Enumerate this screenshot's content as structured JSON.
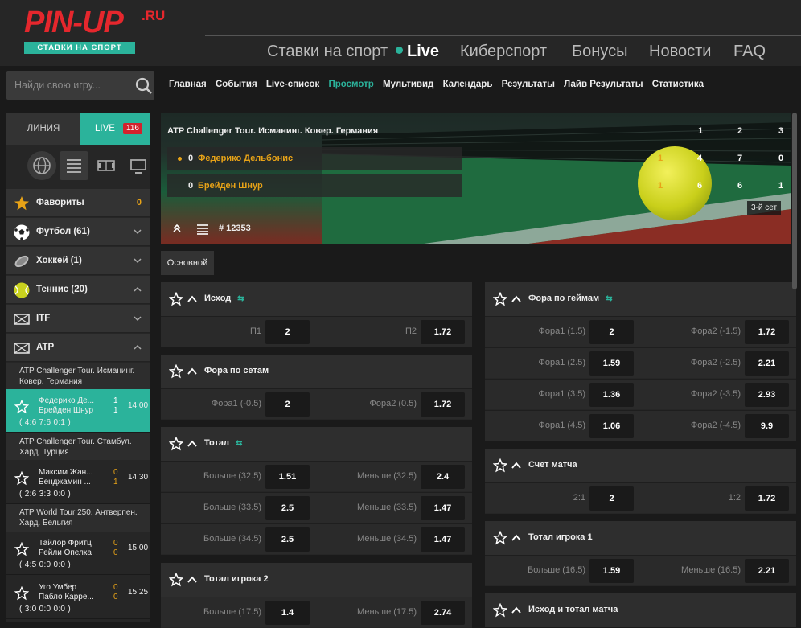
{
  "header": {
    "logo_text": "PIN-UP",
    "logo_ru": ".RU",
    "logo_sub": "СТАВКИ НА СПОРТ",
    "nav": [
      {
        "label": "Ставки на спорт"
      },
      {
        "label": "Live"
      },
      {
        "label": "Киберспорт"
      },
      {
        "label": "Бонусы"
      },
      {
        "label": "Новости"
      },
      {
        "label": "FAQ"
      }
    ]
  },
  "search": {
    "placeholder": "Найди свою игру..."
  },
  "subnav": [
    "Главная",
    "События",
    "Live-список",
    "Просмотр",
    "Мультивид",
    "Календарь",
    "Результаты",
    "Лайв Результаты",
    "Статистика"
  ],
  "sidebar": {
    "tab_line": "ЛИНИЯ",
    "tab_live": "LIVE",
    "live_count": "116",
    "sports": [
      {
        "label": "Фавориты",
        "count": "0"
      },
      {
        "label": "Футбол (61)"
      },
      {
        "label": "Хоккей (1)"
      },
      {
        "label": "Теннис (20)"
      },
      {
        "label": "ITF"
      },
      {
        "label": "ATP"
      }
    ],
    "leagues": [
      "ATP Challenger Tour. Исманинг. Ковер. Германия",
      "ATP Challenger Tour. Стамбул. Хард. Турция",
      "ATP World Tour 250. Антверпен. Хард. Бельгия"
    ],
    "matches": [
      {
        "p1": "Федерико Де...",
        "p2": "Брейден Шнур",
        "s1": "1",
        "s2": "1",
        "time": "14:00",
        "sets": "( 4:6  7:6  0:1 )"
      },
      {
        "p1": "Максим Жан...",
        "p2": "Бенджамин ...",
        "s1": "0",
        "s2": "1",
        "time": "14:30",
        "sets": "( 2:6  3:3  0:0 )"
      },
      {
        "p1": "Тайлор Фритц",
        "p2": "Рейли Опелка",
        "s1": "0",
        "s2": "0",
        "time": "15:00",
        "sets": "( 4:5  0:0  0:0 )"
      },
      {
        "p1": "Уго Умбер",
        "p2": "Пабло Карре...",
        "s1": "0",
        "s2": "0",
        "time": "15:25",
        "sets": "( 3:0  0:0  0:0 )"
      }
    ]
  },
  "event": {
    "title": "ATP Challenger Tour. Исманинг. Ковер. Германия",
    "set_headers": [
      "1",
      "2",
      "3"
    ],
    "players": [
      {
        "serve": "0",
        "name": "Федерико Дельбонис",
        "game": "1",
        "sets": [
          "4",
          "7",
          "0"
        ]
      },
      {
        "serve": "0",
        "name": "Брейден Шнур",
        "game": "1",
        "sets": [
          "6",
          "6",
          "1"
        ]
      }
    ],
    "set_label": "3-й сет",
    "event_id": "# 12353",
    "main_tab": "Основной"
  },
  "markets_left": [
    {
      "title": "Исход",
      "icon": true,
      "rows": [
        {
          "l1": "П1",
          "o1": "2",
          "l2": "П2",
          "o2": "1.72"
        }
      ]
    },
    {
      "title": "Фора по сетам",
      "icon": false,
      "rows": [
        {
          "l1": "Фора1 (-0.5)",
          "o1": "2",
          "l2": "Фора2 (0.5)",
          "o2": "1.72"
        }
      ]
    },
    {
      "title": "Тотал",
      "icon": true,
      "rows": [
        {
          "l1": "Больше (32.5)",
          "o1": "1.51",
          "l2": "Меньше (32.5)",
          "o2": "2.4"
        },
        {
          "l1": "Больше (33.5)",
          "o1": "2.5",
          "l2": "Меньше (33.5)",
          "o2": "1.47"
        },
        {
          "l1": "Больше (34.5)",
          "o1": "2.5",
          "l2": "Меньше (34.5)",
          "o2": "1.47"
        }
      ]
    },
    {
      "title": "Тотал игрока 2",
      "icon": false,
      "rows": [
        {
          "l1": "Больше (17.5)",
          "o1": "1.4",
          "l2": "Меньше (17.5)",
          "o2": "2.74"
        }
      ]
    }
  ],
  "markets_right": [
    {
      "title": "Фора по геймам",
      "icon": true,
      "rows": [
        {
          "l1": "Фора1 (1.5)",
          "o1": "2",
          "l2": "Фора2 (-1.5)",
          "o2": "1.72"
        },
        {
          "l1": "Фора1 (2.5)",
          "o1": "1.59",
          "l2": "Фора2 (-2.5)",
          "o2": "2.21"
        },
        {
          "l1": "Фора1 (3.5)",
          "o1": "1.36",
          "l2": "Фора2 (-3.5)",
          "o2": "2.93"
        },
        {
          "l1": "Фора1 (4.5)",
          "o1": "1.06",
          "l2": "Фора2 (-4.5)",
          "o2": "9.9"
        }
      ]
    },
    {
      "title": "Счет матча",
      "icon": false,
      "rows": [
        {
          "l1": "2:1",
          "o1": "2",
          "l2": "1:2",
          "o2": "1.72"
        }
      ]
    },
    {
      "title": "Тотал игрока 1",
      "icon": false,
      "rows": [
        {
          "l1": "Больше (16.5)",
          "o1": "1.59",
          "l2": "Меньше (16.5)",
          "o2": "2.21"
        }
      ]
    },
    {
      "title": "Исход и тотал матча",
      "icon": false,
      "rows": []
    }
  ]
}
